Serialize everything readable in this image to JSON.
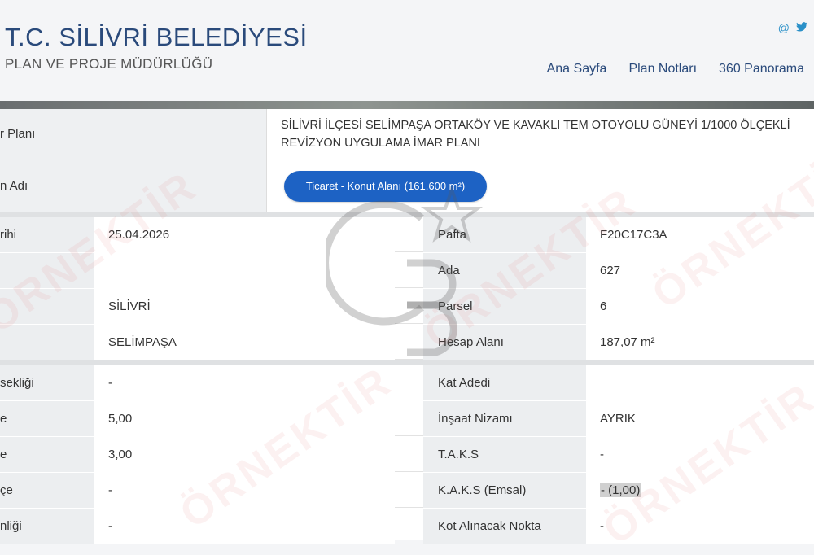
{
  "header": {
    "title": "T.C. SİLİVRİ BELEDİYESİ",
    "subtitle": "PLAN VE PROJE MÜDÜRLÜĞÜ",
    "nav": [
      "Ana Sayfa",
      "Plan Notları",
      "360 Panorama"
    ],
    "social": {
      "email_glyph": "@",
      "twitter_glyph": "🐦"
    }
  },
  "plan": {
    "label": "r Planı",
    "text_line1": "SİLİVRİ İLÇESİ SELİMPAŞA ORTAKÖY VE KAVAKLI TEM OTOYOLU GÜNEYİ 1/1000 ÖLÇEKLİ",
    "text_line2": "REVİZYON UYGULAMA İMAR PLANI"
  },
  "area": {
    "label": "n Adı",
    "chip": "Ticaret - Konut Alanı (161.600 m²)"
  },
  "group1": {
    "left": [
      {
        "label": "rihi",
        "value": "25.04.2026"
      },
      {
        "label": "",
        "value": ""
      },
      {
        "label": "",
        "value": "SİLİVRİ"
      },
      {
        "label": "",
        "value": "SELİMPAŞA"
      }
    ],
    "right": [
      {
        "label": "Pafta",
        "value": "F20C17C3A"
      },
      {
        "label": "Ada",
        "value": "627"
      },
      {
        "label": "Parsel",
        "value": "6"
      },
      {
        "label": "Hesap Alanı",
        "value": "187,07 m²"
      }
    ]
  },
  "group2": {
    "left": [
      {
        "label": "sekliği",
        "value": "-"
      },
      {
        "label": "e",
        "value": "5,00"
      },
      {
        "label": "e",
        "value": "3,00"
      },
      {
        "label": "çe",
        "value": "-"
      },
      {
        "label": "nliği",
        "value": "-"
      }
    ],
    "right": [
      {
        "label": "Kat Adedi",
        "value": ""
      },
      {
        "label": "İnşaat Nizamı",
        "value": "AYRIK"
      },
      {
        "label": "T.A.K.S",
        "value": "-"
      },
      {
        "label": "K.A.K.S (Emsal)",
        "value": "- (1,00)"
      },
      {
        "label": "Kot Alınacak Nokta",
        "value": "-"
      }
    ]
  },
  "watermark": {
    "text": "ÖRNEKTİR",
    "logo": "CB"
  },
  "colors": {
    "title": "#2a4a7b",
    "chip": "#1d62c4",
    "watermark": "#e87878"
  }
}
